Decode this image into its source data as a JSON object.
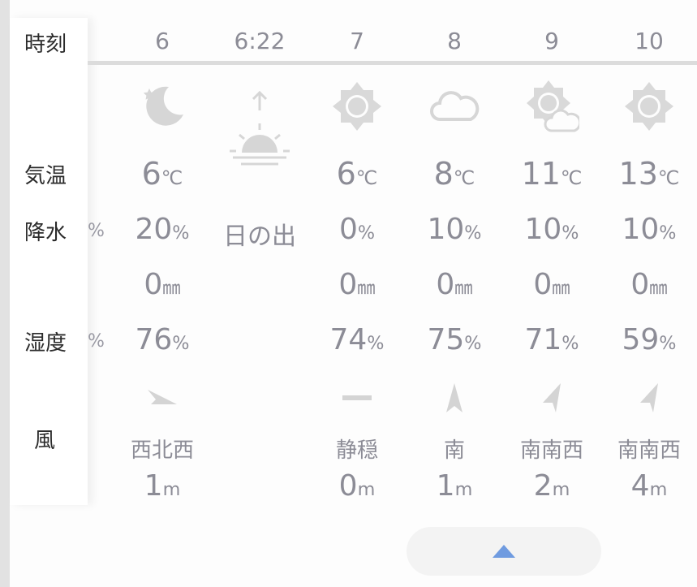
{
  "labels": {
    "time": "時刻",
    "temp": "気温",
    "precip": "降水",
    "humidity": "湿度",
    "wind": "風"
  },
  "columns": [
    {
      "time": "6",
      "weather_icon": "moon-stars-icon",
      "temp": "6",
      "precip": "20",
      "rain": "0",
      "humidity": "76",
      "wind_icon": "arrow-wnw-icon",
      "wind_dir": "西北西",
      "wind_speed": "1"
    },
    {
      "time": "6:22",
      "weather_icon": "sunrise-icon",
      "sunrise_label": "日の出"
    },
    {
      "time": "7",
      "weather_icon": "sun-icon",
      "temp": "6",
      "precip": "0",
      "rain": "0",
      "humidity": "74",
      "wind_icon": "calm-dash-icon",
      "wind_dir": "静穏",
      "wind_speed": "0"
    },
    {
      "time": "8",
      "weather_icon": "cloud-icon",
      "temp": "8",
      "precip": "10",
      "rain": "0",
      "humidity": "75",
      "wind_icon": "arrow-s-icon",
      "wind_dir": "南",
      "wind_speed": "1"
    },
    {
      "time": "9",
      "weather_icon": "sun-cloud-icon",
      "temp": "11",
      "precip": "10",
      "rain": "0",
      "humidity": "71",
      "wind_icon": "arrow-ssw-icon",
      "wind_dir": "南南西",
      "wind_speed": "2"
    },
    {
      "time": "10",
      "weather_icon": "sun-icon",
      "temp": "13",
      "precip": "10",
      "rain": "0",
      "humidity": "59",
      "wind_icon": "arrow-ssw-icon",
      "wind_dir": "南南西",
      "wind_speed": "4"
    }
  ],
  "units": {
    "temp": "℃",
    "percent": "%",
    "mm": "㎜",
    "m": "m"
  },
  "colors": {
    "accent": "#6f9be0",
    "icon": "#d8d8d8",
    "text": "#8c8c96"
  }
}
